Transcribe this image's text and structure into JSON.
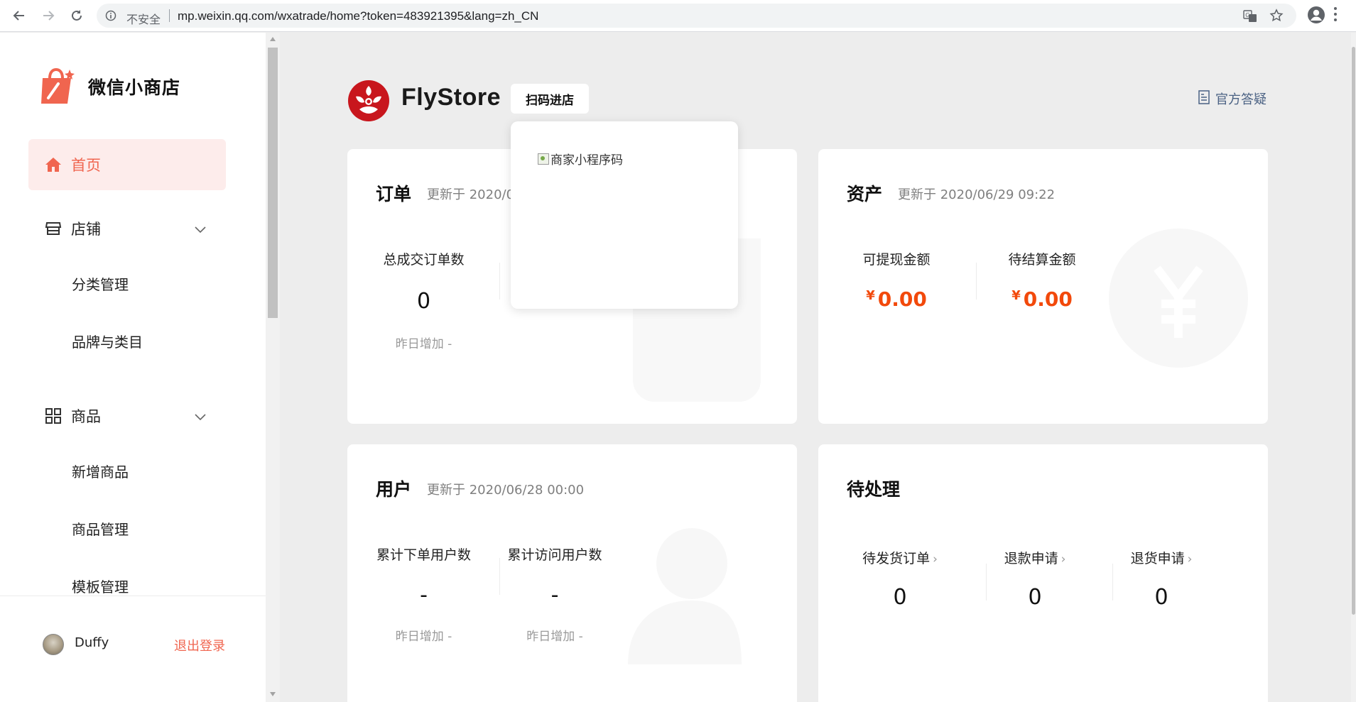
{
  "browser": {
    "insecure_label": "不安全",
    "url": "mp.weixin.qq.com/wxatrade/home?token=483921395&lang=zh_CN"
  },
  "sidebar": {
    "brand_title": "微信小商店",
    "items": [
      {
        "label": "首页",
        "icon": "home-icon",
        "active": true
      },
      {
        "label": "店铺",
        "icon": "store-icon",
        "expandable": true
      },
      {
        "label": "分类管理"
      },
      {
        "label": "品牌与类目"
      },
      {
        "label": "商品",
        "icon": "grid-icon",
        "expandable": true
      },
      {
        "label": "新增商品"
      },
      {
        "label": "商品管理"
      },
      {
        "label": "模板管理"
      }
    ],
    "user": {
      "name": "Duffy",
      "logout_label": "退出登录"
    }
  },
  "header": {
    "store_name": "FlyStore",
    "scan_label": "扫码进店",
    "faq_label": "官方答疑",
    "qr_alt": "商家小程序码"
  },
  "cards": {
    "orders": {
      "title": "订单",
      "updated": "更新于  2020/0",
      "stat_label": "总成交订单数",
      "stat_value": "0",
      "stat_sub": "昨日增加  -"
    },
    "assets": {
      "title": "资产",
      "updated": "更新于  2020/06/29 09:22",
      "currency": "¥",
      "withdrawable_label": "可提现金额",
      "withdrawable_value": "0.00",
      "pending_label": "待结算金额",
      "pending_value": "0.00"
    },
    "users": {
      "title": "用户",
      "updated": "更新于  2020/06/28 00:00",
      "ordering_label": "累计下单用户数",
      "ordering_value": "-",
      "ordering_sub": "昨日增加  -",
      "visiting_label": "累计访问用户数",
      "visiting_value": "-",
      "visiting_sub": "昨日增加  -"
    },
    "pending": {
      "title": "待处理",
      "ship_label": "待发货订单",
      "ship_value": "0",
      "refund_label": "退款申请",
      "refund_value": "0",
      "return_label": "退货申请",
      "return_value": "0"
    }
  },
  "colors": {
    "accent": "#f0654f",
    "money": "#f2490b",
    "link": "#4a6183"
  }
}
